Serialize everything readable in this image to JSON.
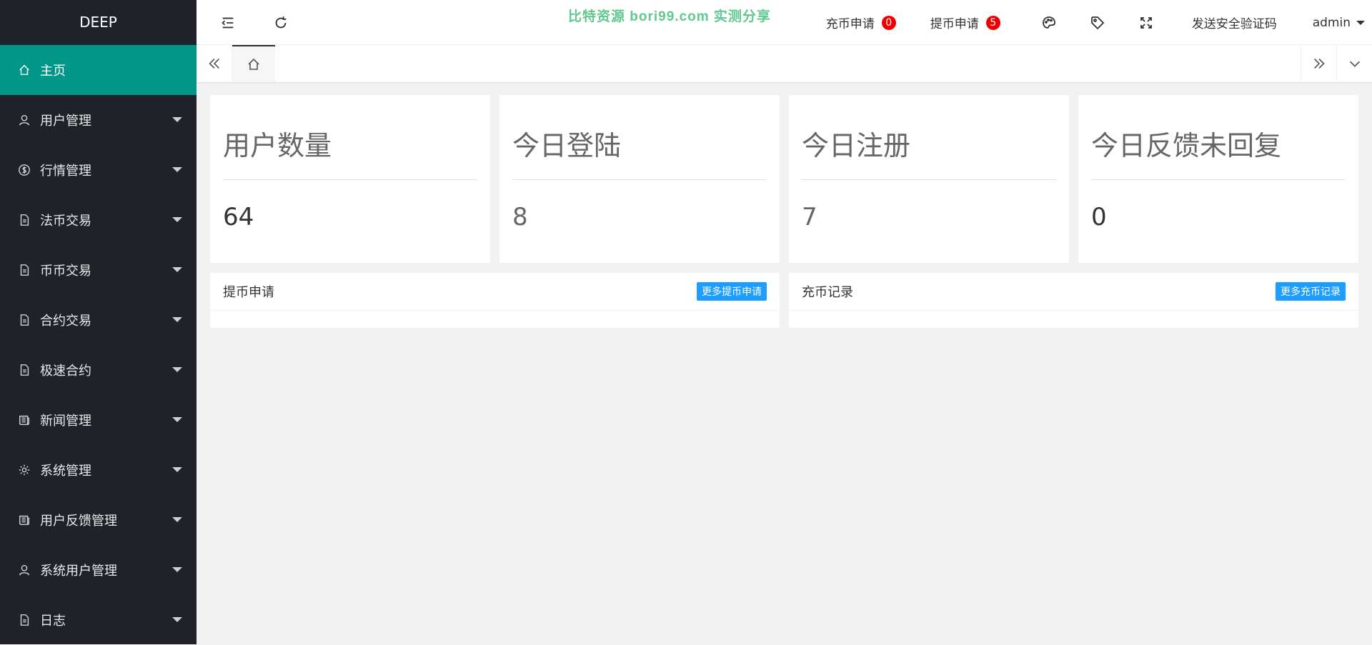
{
  "brand": "DEEP",
  "watermark": "比特资源 bori99.com 实测分享",
  "sidebar": {
    "items": [
      {
        "label": "主页",
        "icon": "home-icon"
      },
      {
        "label": "用户管理",
        "icon": "user-icon"
      },
      {
        "label": "行情管理",
        "icon": "dollar-icon"
      },
      {
        "label": "法币交易",
        "icon": "file-icon"
      },
      {
        "label": "币币交易",
        "icon": "file-icon"
      },
      {
        "label": "合约交易",
        "icon": "file-icon"
      },
      {
        "label": "极速合约",
        "icon": "file-icon"
      },
      {
        "label": "新闻管理",
        "icon": "news-icon"
      },
      {
        "label": "系统管理",
        "icon": "gear-icon"
      },
      {
        "label": "用户反馈管理",
        "icon": "news-icon"
      },
      {
        "label": "系统用户管理",
        "icon": "user-icon"
      },
      {
        "label": "日志",
        "icon": "file-icon"
      }
    ]
  },
  "header": {
    "deposit_label": "充币申请",
    "deposit_count": "0",
    "withdraw_label": "提币申请",
    "withdraw_count": "5",
    "send_code": "发送安全验证码",
    "user": "admin"
  },
  "stats": [
    {
      "title": "用户数量",
      "value": "64"
    },
    {
      "title": "今日登陆",
      "value": "8"
    },
    {
      "title": "今日注册",
      "value": "7"
    },
    {
      "title": "今日反馈未回复",
      "value": "0"
    }
  ],
  "panels": {
    "withdraw": {
      "title": "提币申请",
      "button": "更多提币申请"
    },
    "deposit": {
      "title": "充币记录",
      "button": "更多充币记录"
    }
  },
  "colors": {
    "sidebar_bg": "#20222a",
    "active_green": "#009688",
    "badge_red": "#ee0000",
    "button_blue": "#1e9fff"
  }
}
